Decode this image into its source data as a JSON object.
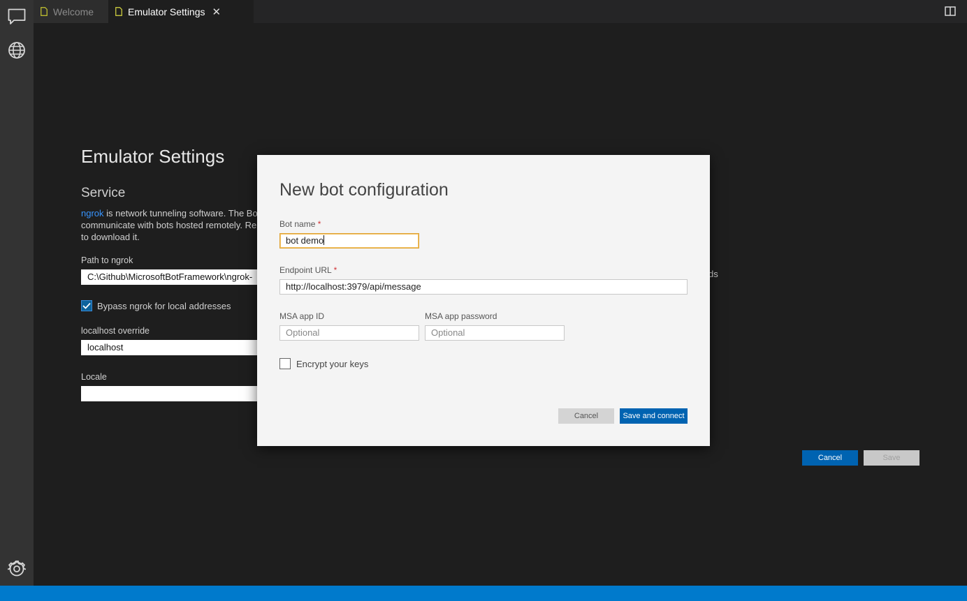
{
  "activity_bar": {
    "icons": [
      "chat-icon",
      "globe-icon",
      "gear-icon"
    ]
  },
  "tabs": [
    {
      "label": "Welcome",
      "active": false
    },
    {
      "label": "Emulator Settings",
      "active": true,
      "close": "✕"
    }
  ],
  "settings": {
    "title": "Emulator Settings",
    "section": "Service",
    "description_link": "ngrok",
    "description_line1": " is network tunneling software. The Bo",
    "description_line2": "communicate with bots hosted remotely. Re",
    "description_line3": "to download it.",
    "path_label": "Path to ngrok",
    "path_value": "C:\\Github\\MicrosoftBotFramework\\ngrok-",
    "bypass_label": "Bypass ngrok for local addresses",
    "bypass_checked": true,
    "localhost_label": "localhost override",
    "localhost_value": "localhost",
    "locale_label": "Locale",
    "locale_value": "",
    "right_fragment": "ds",
    "cancel_label": "Cancel",
    "save_label": "Save"
  },
  "dialog": {
    "title": "New bot configuration",
    "bot_name_label": "Bot name",
    "bot_name_value": "bot demo",
    "endpoint_label": "Endpoint URL",
    "endpoint_value": "http://localhost:3979/api/message",
    "required_mark": "*",
    "app_id_label": "MSA app ID",
    "app_id_placeholder": "Optional",
    "app_password_label": "MSA app password",
    "app_password_placeholder": "Optional",
    "encrypt_label": "Encrypt your keys",
    "encrypt_checked": false,
    "cancel_label": "Cancel",
    "submit_label": "Save and connect"
  },
  "colors": {
    "accent": "#0063b1",
    "status_bar": "#007acc",
    "link": "#3794ff"
  }
}
